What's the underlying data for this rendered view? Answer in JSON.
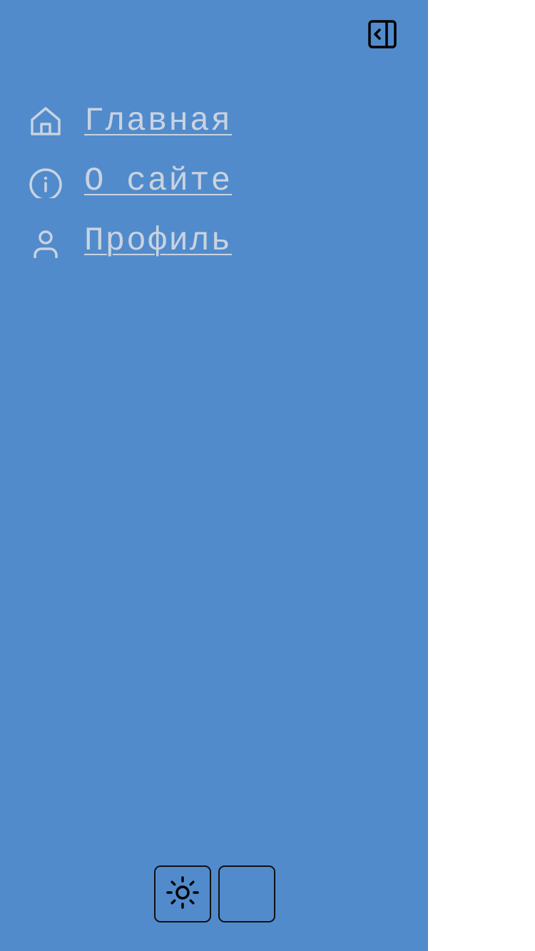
{
  "sidebar": {
    "background_color": "#518bcc",
    "collapse_button": {
      "icon": "sidebar-collapse-icon"
    },
    "items": [
      {
        "label": "Главная",
        "icon": "home-icon"
      },
      {
        "label": "О сайте",
        "icon": "info-icon"
      },
      {
        "label": "Профиль",
        "icon": "user-icon"
      }
    ],
    "link_color": "#c9d3e0"
  },
  "footer": {
    "theme_button": {
      "icon": "sun-icon"
    },
    "second_button": {
      "icon": ""
    }
  }
}
